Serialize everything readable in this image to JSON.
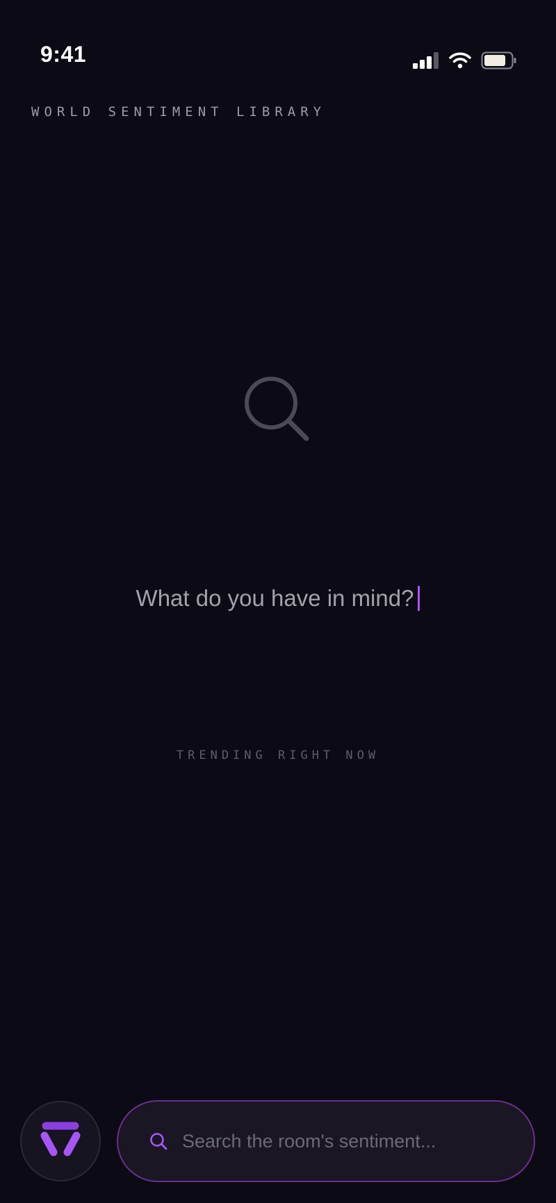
{
  "status": {
    "time": "9:41"
  },
  "header": {
    "title": "WORLD SENTIMENT LIBRARY"
  },
  "main": {
    "hero_icon": "search-icon",
    "prompt": "What do you have in mind?",
    "trending_label": "TRENDING RIGHT NOW"
  },
  "bottom_bar": {
    "logo_icon": "brand-logo-icon",
    "search_icon": "search-icon",
    "search_placeholder": "Search the room's sentiment...",
    "search_value": ""
  },
  "colors": {
    "background": "#0c0a14",
    "accent": "#a855f7",
    "search_border": "#6b2f8c"
  }
}
